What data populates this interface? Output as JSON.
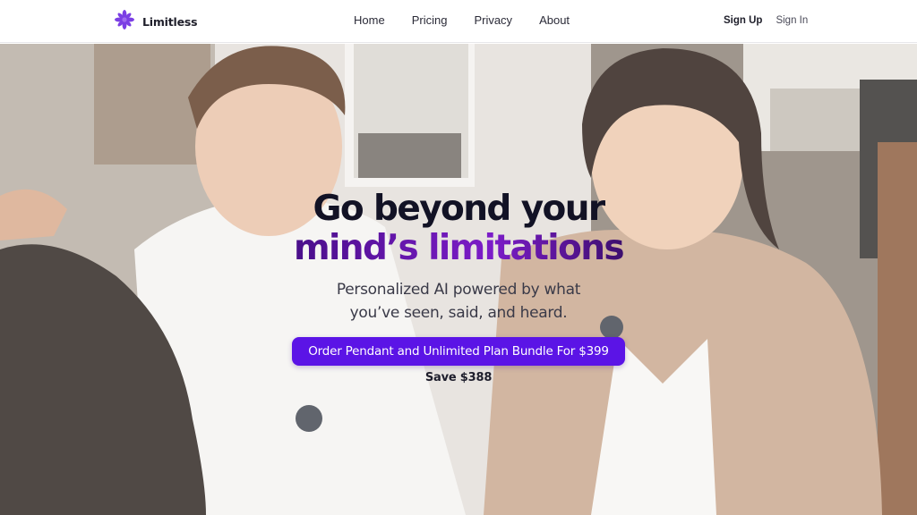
{
  "header": {
    "brand": "Limitless",
    "nav": [
      "Home",
      "Pricing",
      "Privacy",
      "About"
    ],
    "sign_up": "Sign Up",
    "sign_in": "Sign In"
  },
  "hero": {
    "headline_line1": "Go beyond your",
    "headline_line2": "mind’s limitations",
    "subhead_line1": "Personalized AI powered by what",
    "subhead_line2": "you’ve seen, said, and heard.",
    "cta_label": "Order Pendant and Unlimited Plan Bundle For $399",
    "save_text": "Save $388"
  },
  "icons": {
    "logo": "limitless-star-icon"
  },
  "colors": {
    "brand_purple": "#5b14e6",
    "headline_dark": "#121225",
    "headline_purple": "#6a16b8"
  }
}
